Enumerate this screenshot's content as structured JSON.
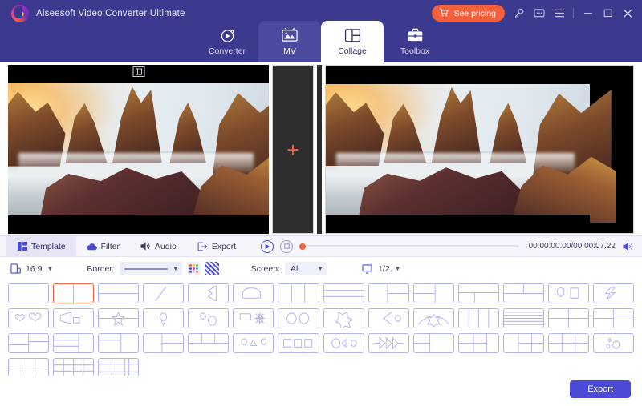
{
  "app": {
    "title": "Aiseesoft Video Converter Ultimate",
    "logo_icon": "aiseesoft-logo-icon"
  },
  "titlebar": {
    "pricing_label": "See pricing",
    "cart_icon": "cart-icon",
    "key_icon": "key-icon",
    "feedback_icon": "feedback-icon",
    "menu_icon": "hamburger-menu-icon",
    "minimize_icon": "minimize-icon",
    "maximize_icon": "maximize-icon",
    "close_icon": "close-icon"
  },
  "main_tabs": [
    {
      "label": "Converter",
      "icon": "converter-icon",
      "state": "inactive"
    },
    {
      "label": "MV",
      "icon": "mv-icon",
      "state": "hover"
    },
    {
      "label": "Collage",
      "icon": "collage-icon",
      "state": "active"
    },
    {
      "label": "Toolbox",
      "icon": "toolbox-icon",
      "state": "inactive"
    }
  ],
  "preview": {
    "clip_badge_icon": "film-clip-icon",
    "add_media_icon": "plus-icon"
  },
  "tool_tabs": [
    {
      "label": "Template",
      "icon": "template-icon",
      "state": "active"
    },
    {
      "label": "Filter",
      "icon": "filter-cloud-icon",
      "state": "inactive"
    },
    {
      "label": "Audio",
      "icon": "audio-speaker-icon",
      "state": "inactive"
    },
    {
      "label": "Export",
      "icon": "export-arrow-icon",
      "state": "inactive"
    }
  ],
  "player": {
    "play_icon": "play-circle-icon",
    "stop_icon": "stop-circle-icon",
    "progress_percent": 0,
    "current_time": "00:00:00.00",
    "total_time": "00:00:07.22",
    "timecode": "00:00:00.00/00:00:07.22",
    "volume_icon": "volume-icon"
  },
  "options": {
    "ratio_icon": "aspect-ratio-icon",
    "ratio_value": "16:9",
    "border_label": "Border:",
    "border_style_value": "solid-line",
    "border_color_icon": "color-palette-icon",
    "border_pattern_icon": "stripe-pattern-icon",
    "screen_label": "Screen:",
    "screen_value": "All",
    "page_icon": "monitor-icon",
    "page_value": "1/2"
  },
  "templates": {
    "selected_index": 1,
    "items": [
      {
        "name": "single-pane",
        "layout": "single"
      },
      {
        "name": "vertical-split-2",
        "layout": "v2"
      },
      {
        "name": "horizontal-split-2",
        "layout": "h2"
      },
      {
        "name": "diagonal-split",
        "layout": "diag"
      },
      {
        "name": "arrow-notch-split",
        "layout": "notch"
      },
      {
        "name": "rounded-blob",
        "layout": "blob"
      },
      {
        "name": "vertical-split-3",
        "layout": "v3"
      },
      {
        "name": "horizontal-split-3",
        "layout": "h3"
      },
      {
        "name": "left-big-right-stack",
        "layout": "l1r2"
      },
      {
        "name": "right-big-left-stack",
        "layout": "r1l2"
      },
      {
        "name": "top-bar-bottom-split",
        "layout": "t1b2"
      },
      {
        "name": "top-split-bottom-bar",
        "layout": "t2b1"
      },
      {
        "name": "hexagon-square",
        "layout": "hexsq"
      },
      {
        "name": "lightning-shape",
        "layout": "bolt"
      },
      {
        "name": "two-hearts",
        "layout": "hearts"
      },
      {
        "name": "megaphone-shape",
        "layout": "megaphone"
      },
      {
        "name": "star-banner",
        "layout": "star"
      },
      {
        "name": "balloon-shape",
        "layout": "balloon"
      },
      {
        "name": "two-circles-small",
        "layout": "circ2"
      },
      {
        "name": "flag-gear",
        "layout": "flaggear"
      },
      {
        "name": "two-circles-large",
        "layout": "circ2b"
      },
      {
        "name": "puzzle-shape",
        "layout": "puzzle"
      },
      {
        "name": "flower-bracket",
        "layout": "flower"
      },
      {
        "name": "arch-flower",
        "layout": "arch"
      },
      {
        "name": "vertical-split-4",
        "layout": "v4"
      },
      {
        "name": "horizontal-split-5",
        "layout": "h5"
      },
      {
        "name": "quad-grid",
        "layout": "quad"
      },
      {
        "name": "left-split-right-stack",
        "layout": "l2r2"
      },
      {
        "name": "t-shape-split",
        "layout": "tshape"
      },
      {
        "name": "left-stack-right-big",
        "layout": "ls-rb"
      },
      {
        "name": "left-big-right-split-h",
        "layout": "lb-rs"
      },
      {
        "name": "bottom-three-split",
        "layout": "b3"
      },
      {
        "name": "top-two-bottom-wide",
        "layout": "t2bw"
      },
      {
        "name": "three-circles-row",
        "layout": "circ3"
      },
      {
        "name": "three-squares-row",
        "layout": "sq3"
      },
      {
        "name": "circle-play-circle",
        "layout": "cpc"
      },
      {
        "name": "triple-arrow",
        "layout": "arrows"
      },
      {
        "name": "grid-2x2-split",
        "layout": "g2x2"
      },
      {
        "name": "grid-left-stack-right",
        "layout": "gl-sr"
      },
      {
        "name": "grid-2x2-right-big",
        "layout": "g22rb"
      },
      {
        "name": "grid-cross-split",
        "layout": "gcross"
      },
      {
        "name": "bubbles-shape",
        "layout": "bubbles"
      },
      {
        "name": "grid-2x3",
        "layout": "g2x3"
      },
      {
        "name": "grid-3x3",
        "layout": "g3x3"
      },
      {
        "name": "grid-mixed-rows",
        "layout": "gmixed"
      }
    ]
  },
  "footer": {
    "export_label": "Export"
  },
  "colors": {
    "header_bg": "#3b3a8f",
    "accent_orange": "#f4603c",
    "accent_blue": "#4b4ad6",
    "template_stroke": "#b3b3ee"
  }
}
